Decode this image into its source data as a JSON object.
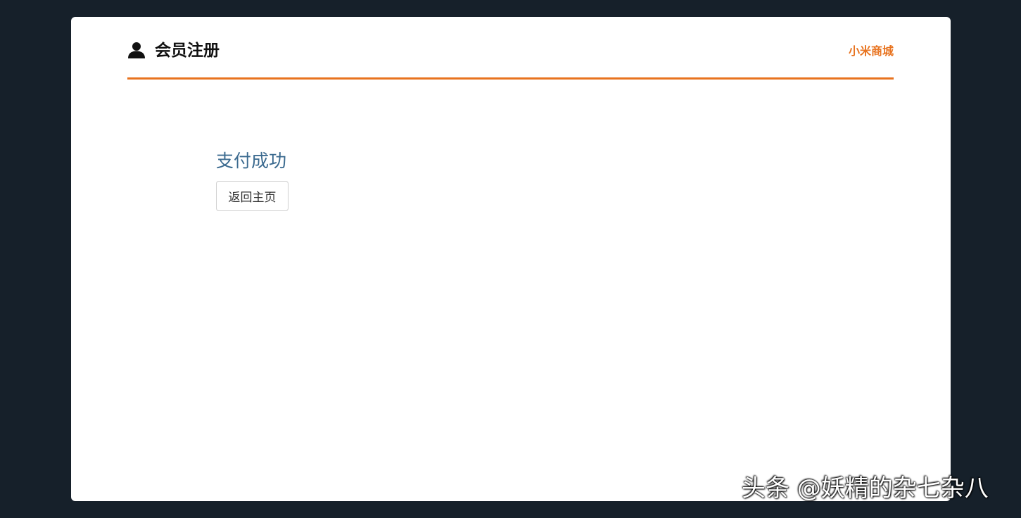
{
  "header": {
    "title": "会员注册",
    "icon": "user-icon",
    "brand_link": "小米商城",
    "accent_color": "#e8731f"
  },
  "main": {
    "heading": "支付成功",
    "home_button_label": "返回主页"
  },
  "watermark": {
    "text": "头条 @妖精的杂七杂八"
  }
}
